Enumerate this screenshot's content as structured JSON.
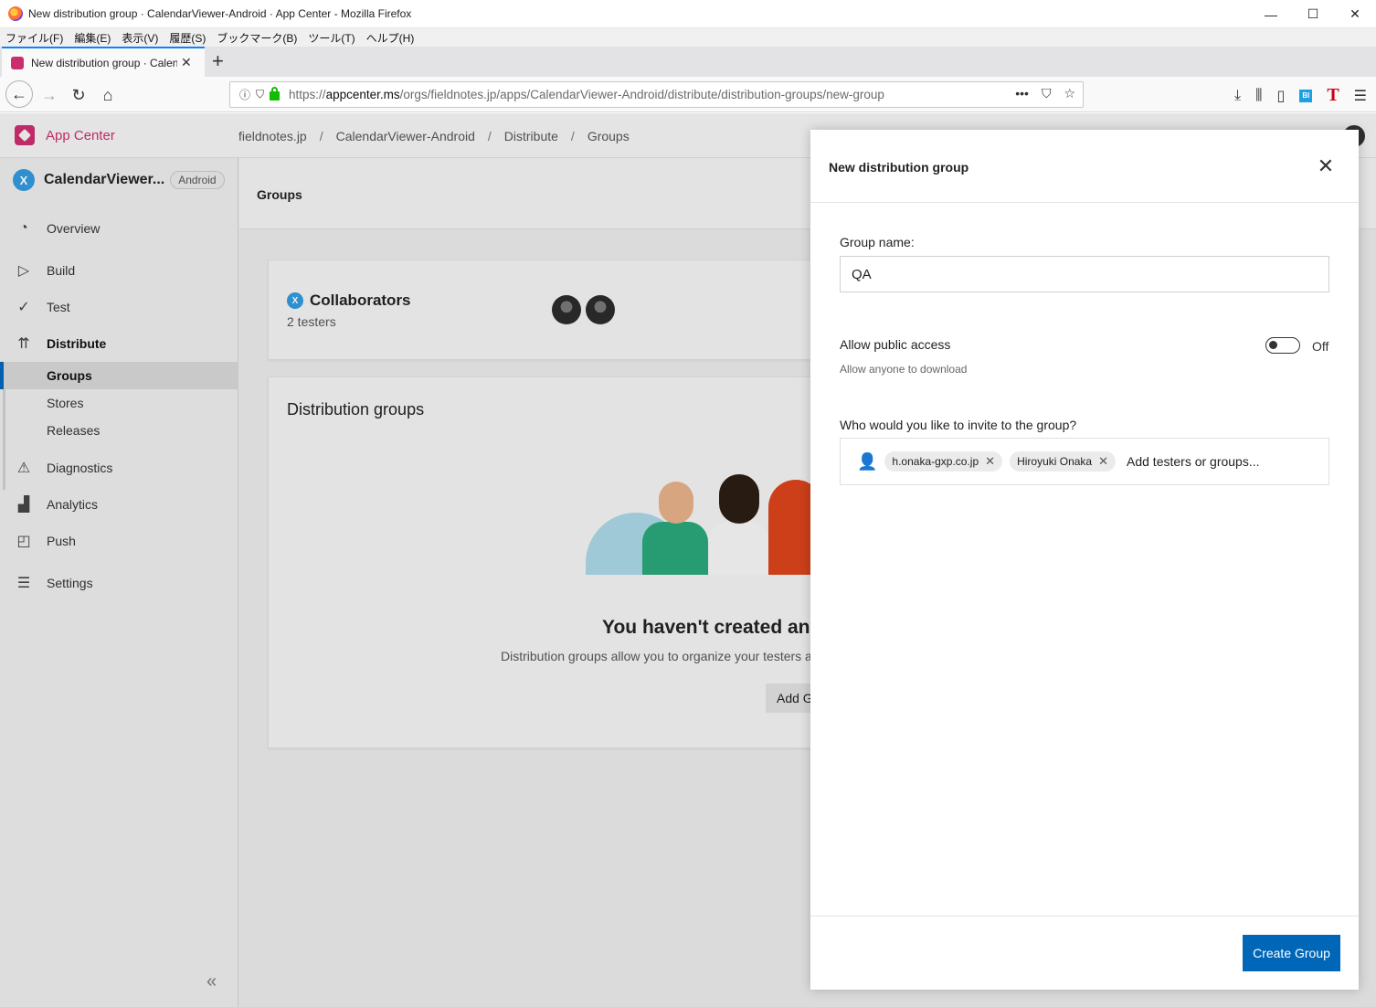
{
  "window": {
    "title": "New distribution group · CalendarViewer-Android · App Center - Mozilla Firefox",
    "controls": {
      "minimize": "—",
      "maximize": "☐",
      "close": "✕"
    }
  },
  "menubar": [
    "ファイル(F)",
    "編集(E)",
    "表示(V)",
    "履歴(S)",
    "ブックマーク(B)",
    "ツール(T)",
    "ヘルプ(H)"
  ],
  "tab": {
    "label": "New distribution group · CalendarViewer-Android · App Center",
    "close": "✕",
    "new_tab": "+"
  },
  "urlbar": {
    "scheme": "https://",
    "host": "appcenter.ms",
    "path": "/orgs/fieldnotes.jp/apps/CalendarViewer-Android/distribute/distribution-groups/new-group",
    "actions": [
      "•••",
      "⛉",
      "☆"
    ]
  },
  "app": {
    "brand": "App Center",
    "breadcrumb": [
      "fieldnotes.jp",
      "CalendarViewer-Android",
      "Distribute",
      "Groups"
    ],
    "app_name": "CalendarViewer...",
    "app_initial": "X",
    "platform": "Android"
  },
  "sidebar": {
    "items": [
      {
        "label": "Overview",
        "icon": "gauge-icon"
      },
      {
        "label": "Build",
        "icon": "play-icon"
      },
      {
        "label": "Test",
        "icon": "check-circle-icon"
      },
      {
        "label": "Distribute",
        "icon": "distribute-icon"
      },
      {
        "label": "Diagnostics",
        "icon": "warning-icon"
      },
      {
        "label": "Analytics",
        "icon": "bar-chart-icon"
      },
      {
        "label": "Push",
        "icon": "push-icon"
      },
      {
        "label": "Settings",
        "icon": "sliders-icon"
      }
    ],
    "distribute_sub": [
      "Groups",
      "Stores",
      "Releases"
    ],
    "collapse": "«"
  },
  "main": {
    "header_title": "Groups",
    "collaborators": {
      "title": "Collaborators",
      "subtitle": "2 testers"
    },
    "distribution_groups": {
      "title": "Distribution groups",
      "empty_title": "You haven't created any",
      "empty_desc": "Distribution groups allow you to organize your testers a",
      "add_button": "Add G"
    }
  },
  "panel": {
    "title": "New distribution group",
    "close": "✕",
    "group_name_label": "Group name:",
    "group_name_value": "QA",
    "public_access_label": "Allow public access",
    "public_access_state": "Off",
    "public_access_hint": "Allow anyone to download",
    "invite_label": "Who would you like to invite to the group?",
    "invitees": [
      "h.onaka-gxp.co.jp",
      "Hiroyuki Onaka"
    ],
    "invite_placeholder": "Add testers or groups...",
    "create_button": "Create Group"
  }
}
